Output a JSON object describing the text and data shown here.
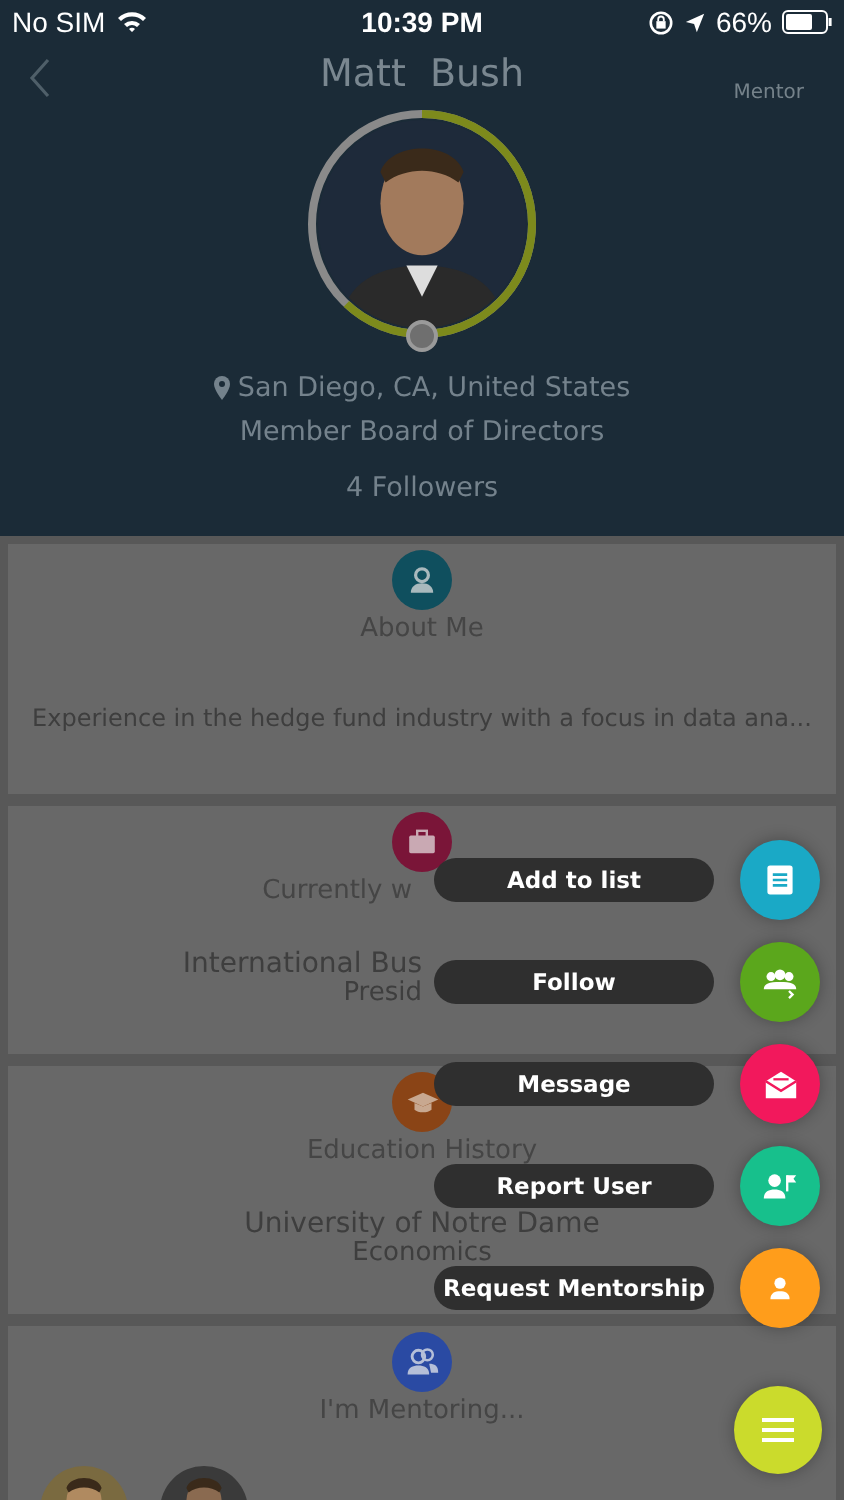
{
  "status_bar": {
    "carrier": "No SIM",
    "time": "10:39 PM",
    "battery": "66%"
  },
  "header": {
    "title": "Matt  Bush",
    "badge": "Mentor",
    "location": "San Diego, CA, United States",
    "position": "Member Board of Directors",
    "followers": "4 Followers"
  },
  "cards": [
    {
      "kind": "text",
      "color": "#0f4f5e",
      "title": "About Me",
      "lines": [
        "Experience in the hedge fund industry with a focus in data ana..."
      ]
    },
    {
      "kind": "covered",
      "color": "#7a1538",
      "title": "Currently w",
      "lines": [
        "International Bus",
        "Presid"
      ]
    },
    {
      "kind": "text",
      "color": "#8a4416",
      "title": "Education History",
      "lines": [
        "University of Notre Dame",
        "Economics"
      ]
    },
    {
      "kind": "people",
      "color": "#2a4aa3",
      "title": "I'm Mentoring..."
    }
  ],
  "action_menu": [
    {
      "label": "Add to list",
      "color": "#1aa9c6"
    },
    {
      "label": "Follow",
      "color": "#5ba71c"
    },
    {
      "label": "Message",
      "color": "#f2185c"
    },
    {
      "label": "Report User",
      "color": "#17c08c"
    },
    {
      "label": "Request Mentorship",
      "color": "#ff9d1b"
    }
  ],
  "menu_button": {
    "color": "#cbdb2c"
  }
}
